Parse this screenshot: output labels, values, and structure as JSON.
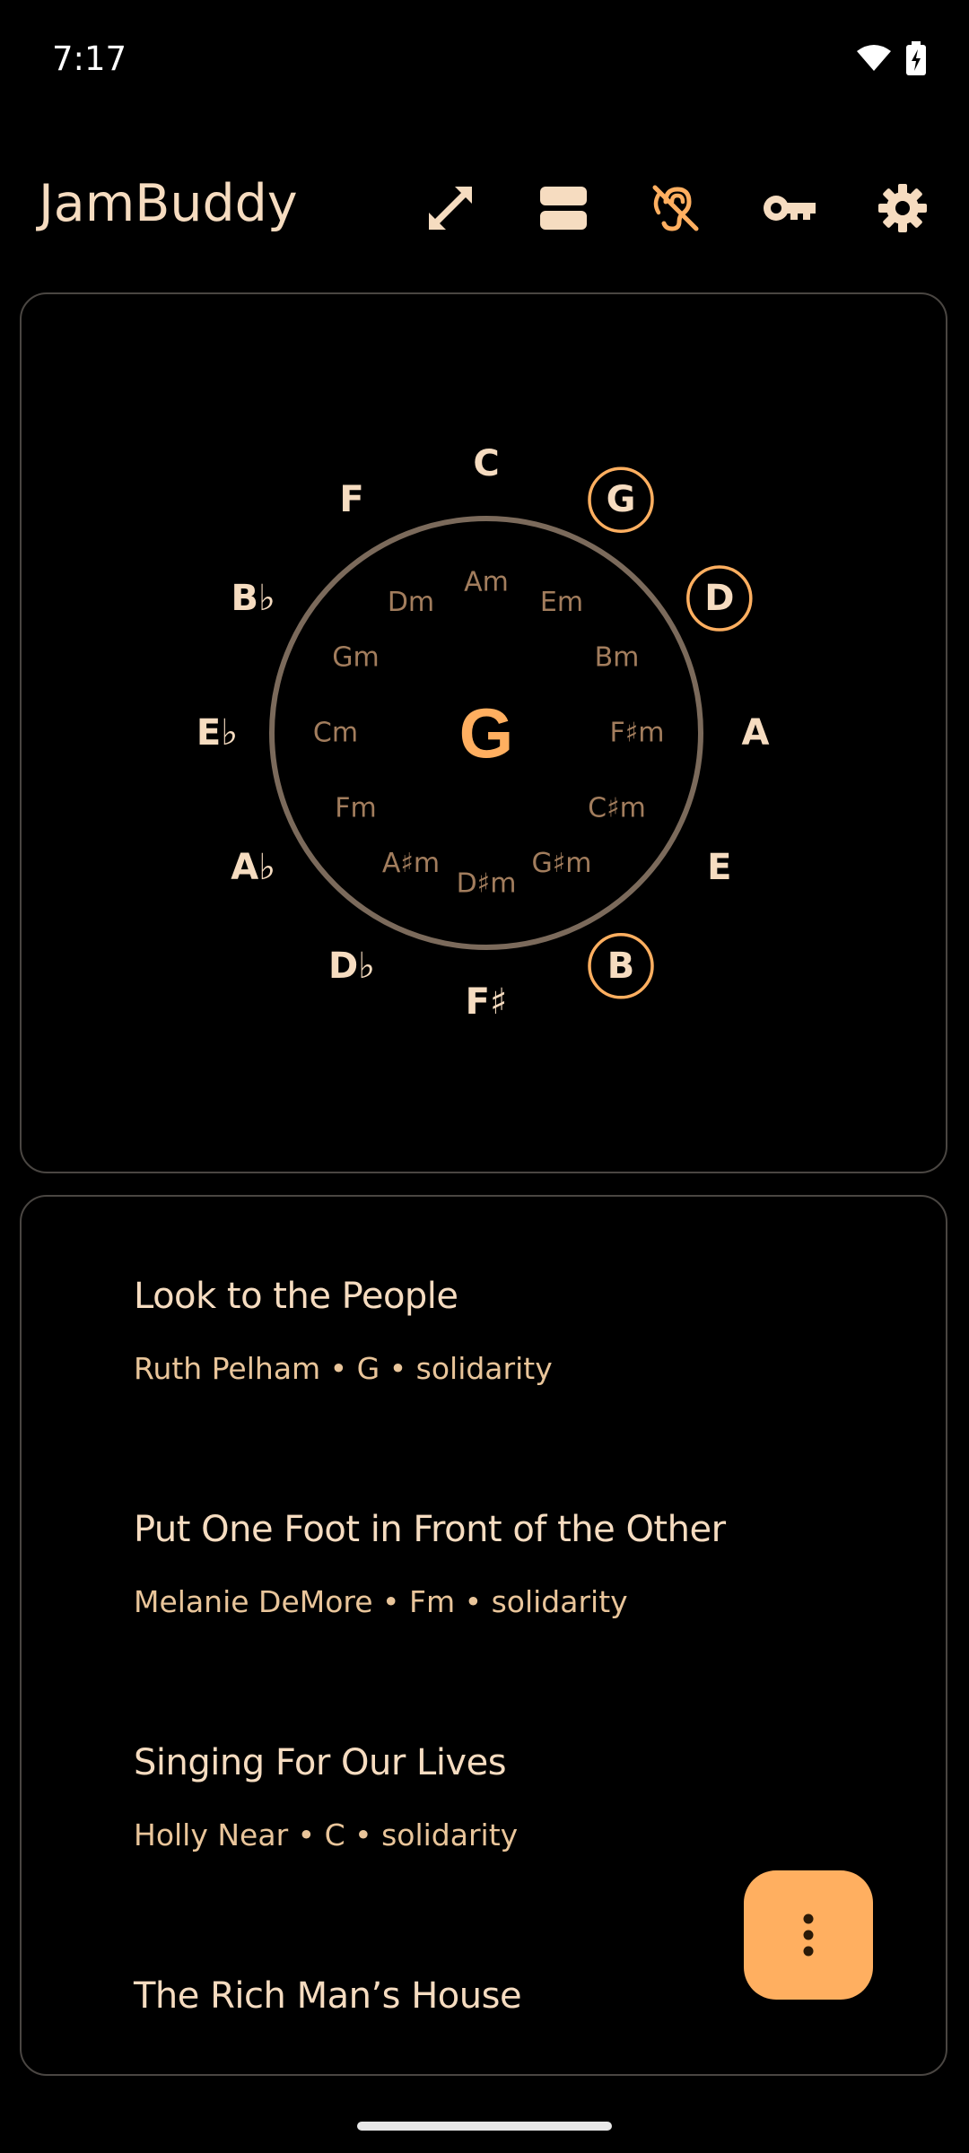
{
  "status": {
    "time": "7:17"
  },
  "app": {
    "title": "JamBuddy"
  },
  "actions": [
    {
      "name": "fullscreen-button",
      "icon": "expand-diagonal-icon"
    },
    {
      "name": "layout-button",
      "icon": "split-view-icon"
    },
    {
      "name": "hearing-off-button",
      "icon": "hearing-disabled-icon"
    },
    {
      "name": "key-button",
      "icon": "key-icon"
    },
    {
      "name": "settings-button",
      "icon": "gear-icon"
    }
  ],
  "wheel": {
    "current_key": "G",
    "major": [
      "C",
      "G",
      "D",
      "A",
      "E",
      "B",
      "F♯",
      "D♭",
      "A♭",
      "E♭",
      "B♭",
      "F"
    ],
    "minor": [
      "Am",
      "Em",
      "Bm",
      "F♯m",
      "C♯m",
      "G♯m",
      "D♯m",
      "A♯m",
      "Fm",
      "Cm",
      "Gm",
      "Dm"
    ],
    "highlighted": [
      "G",
      "D",
      "B"
    ]
  },
  "songs": [
    {
      "title": "Look to the People",
      "meta": "Ruth Pelham • G • solidarity"
    },
    {
      "title": "Put One Foot in Front of the Other",
      "meta": "Melanie DeMore • Fm • solidarity"
    },
    {
      "title": "Singing For Our Lives",
      "meta": "Holly Near • C • solidarity"
    },
    {
      "title": "The Rich Man’s House",
      "meta": ""
    }
  ],
  "colors": {
    "accent": "#ffaf60",
    "text": "#f6dcc0",
    "minor_text": "#a27d5d",
    "ring": "#7b6a5b"
  }
}
